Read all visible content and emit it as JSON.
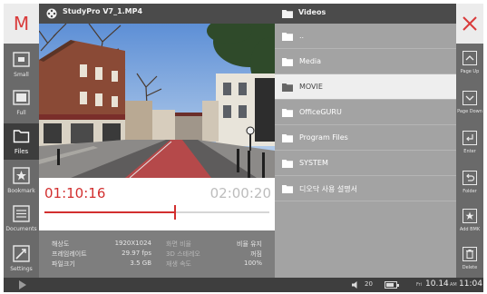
{
  "app": {
    "brand": "M",
    "file_title": "StudyPro V7_1.MP4"
  },
  "sidebar": {
    "items": [
      {
        "label": "Small"
      },
      {
        "label": "Full"
      },
      {
        "label": "Files"
      },
      {
        "label": "Bookmark"
      },
      {
        "label": "Documents"
      },
      {
        "label": "Settings"
      }
    ]
  },
  "player": {
    "current_time": "01:10:16",
    "total_time": "02:00:20",
    "progress": 0.58
  },
  "info": {
    "rows": [
      {
        "k1": "해상도",
        "v1": "1920X1024",
        "k2": "화면 비율",
        "v2": "비율 유지"
      },
      {
        "k1": "프레임레이트",
        "v1": "29.97 fps",
        "k2": "3D 스테레오",
        "v2": "꺼짐"
      },
      {
        "k1": "파일크기",
        "v1": "3.5 GB",
        "k2": "재생 속도",
        "v2": "100%"
      }
    ]
  },
  "browser": {
    "title": "Videos",
    "items": [
      {
        "name": ".."
      },
      {
        "name": "Media"
      },
      {
        "name": "MOVIE",
        "selected": true
      },
      {
        "name": "OfficeGURU"
      },
      {
        "name": "Program Files"
      },
      {
        "name": "SYSTEM"
      },
      {
        "name": "디오닥 사용 설명서"
      }
    ]
  },
  "right_bar": {
    "items": [
      {
        "label": "Page Up"
      },
      {
        "label": "Page Down"
      },
      {
        "label": "Enter"
      },
      {
        "label": "Folder"
      },
      {
        "label": "Add BMK"
      },
      {
        "label": "Delete"
      }
    ]
  },
  "status": {
    "volume": "20",
    "battery_level": 0.8,
    "day": "Fri",
    "date": "10.14",
    "ampm": "AM",
    "time": "11:04"
  },
  "colors": {
    "accent": "#d22f2f",
    "selected_row": "#eeeeee",
    "list_bg": "#a3a3a3"
  }
}
